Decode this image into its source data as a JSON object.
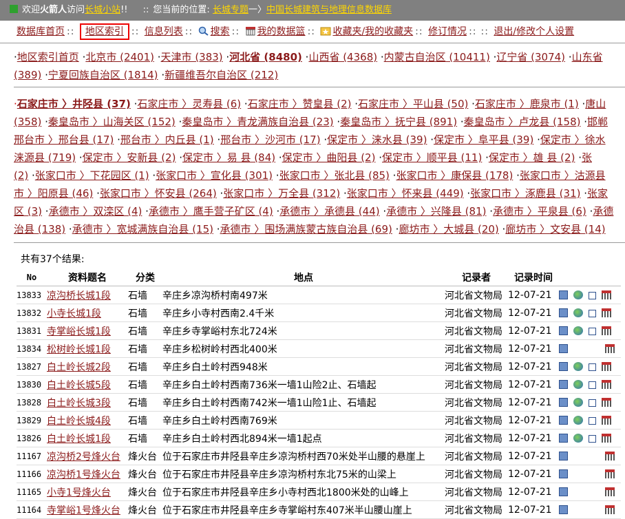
{
  "topbar": {
    "welcome_prefix": "欢迎",
    "user": "火箭人",
    "welcome_mid": "访问",
    "site_link": "长城小站",
    "welcome_suffix": "!!",
    "location_label": "您当前的位置:",
    "crumb_1": "长城专题",
    "crumb_arrow": "一〉",
    "crumb_2": "中国长城建筑与地理信息数据库"
  },
  "nav": {
    "items": [
      "数据库首页",
      "地区索引",
      "信息列表",
      "搜索",
      "我的数据篮",
      "收藏夹/我的收藏夹",
      "修订情况",
      "退出/修改个人设置"
    ],
    "dots": "::"
  },
  "regions": {
    "items": [
      "地区索引首页",
      "北京市 (2401)",
      "天津市 (383)",
      "河北省 (8480)",
      "山西省 (4368)",
      "内蒙古自治区 (10411)",
      "辽宁省 (3074)",
      "山东省",
      "(389)",
      "宁夏回族自治区 (1814)",
      "新疆维吾尔自治区 (212)"
    ]
  },
  "counties": {
    "current": "石家庄市 〉井陉县 (37)",
    "lines": [
      [
        "石家庄市 〉灵寿县 (6)",
        "石家庄市 〉赞皇县 (2)",
        "石家庄市 〉平山县 (50)",
        "石家庄市 〉鹿泉市 (1)",
        "唐山"
      ],
      [
        "(358)",
        "秦皇岛市 〉山海关区 (152)",
        "秦皇岛市 〉青龙满族自治县 (23)",
        "秦皇岛市 〉抚宁县 (891)",
        "秦皇岛市 〉卢龙县 (158)",
        "邯郸"
      ],
      [
        "邢台市 〉邢台县 (17)",
        "邢台市 〉内丘县 (1)",
        "邢台市 〉沙河市 (17)",
        "保定市 〉涞水县 (39)",
        "保定市 〉阜平县 (39)",
        "保定市 〉徐水"
      ],
      [
        "涞源县 (719)",
        "保定市 〉安新县 (2)",
        "保定市 〉易  县 (84)",
        "保定市 〉曲阳县 (2)",
        "保定市 〉顺平县 (11)",
        "保定市 〉雄  县 (2)",
        "张"
      ],
      [
        "(2)",
        "张家口市 〉下花园区 (1)",
        "张家口市 〉宣化县 (301)",
        "张家口市 〉张北县 (85)",
        "张家口市 〉康保县 (178)",
        "张家口市 〉沽源县"
      ],
      [
        "市 〉阳原县 (46)",
        "张家口市 〉怀安县 (264)",
        "张家口市 〉万全县 (312)",
        "张家口市 〉怀来县 (449)",
        "张家口市 〉涿鹿县 (31)",
        "张家"
      ],
      [
        "区 (3)",
        "承德市 〉双滦区 (4)",
        "承德市 〉鹰手营子矿区 (4)",
        "承德市 〉承德县 (44)",
        "承德市 〉兴隆县 (81)",
        "承德市 〉平泉县 (6)",
        "承德"
      ],
      [
        "治县 (138)",
        "承德市 〉宽城满族自治县 (15)",
        "承德市 〉围场满族蒙古族自治县 (69)",
        "廊坊市 〉大城县 (20)",
        "廊坊市 〉文安县 (14)"
      ]
    ]
  },
  "results": {
    "total": "共有37个结果:",
    "headers": [
      "No",
      "资料题名",
      "分类",
      "地点",
      "记录者",
      "记录时间"
    ],
    "rows": [
      {
        "no": "13833",
        "title": "凉沟桥长城1段",
        "type": "石墙",
        "loc": "辛庄乡凉沟桥村南497米",
        "rec": "河北省文物局",
        "time": "12-07-21",
        "icons": 4
      },
      {
        "no": "13832",
        "title": "小寺长城1段",
        "type": "石墙",
        "loc": "辛庄乡小寺村西南2.4千米",
        "rec": "河北省文物局",
        "time": "12-07-21",
        "icons": 4
      },
      {
        "no": "13831",
        "title": "寺掌峪长城1段",
        "type": "石墙",
        "loc": "辛庄乡寺掌峪村东北724米",
        "rec": "河北省文物局",
        "time": "12-07-21",
        "icons": 4
      },
      {
        "no": "13834",
        "title": "松树岭长城1段",
        "type": "石墙",
        "loc": "辛庄乡松树岭村西北400米",
        "rec": "河北省文物局",
        "time": "12-07-21",
        "icons": 2
      },
      {
        "no": "13827",
        "title": "白土岭长城2段",
        "type": "石墙",
        "loc": "辛庄乡白土岭村西948米",
        "rec": "河北省文物局",
        "time": "12-07-21",
        "icons": 4
      },
      {
        "no": "13830",
        "title": "白土岭长城5段",
        "type": "石墙",
        "loc": "辛庄乡白土岭村西南736米一墙1山险2止、石墙起",
        "rec": "河北省文物局",
        "time": "12-07-21",
        "icons": 4
      },
      {
        "no": "13828",
        "title": "白土岭长城3段",
        "type": "石墙",
        "loc": "辛庄乡白土岭村西南742米一墙1山险1止、石墙起",
        "rec": "河北省文物局",
        "time": "12-07-21",
        "icons": 4
      },
      {
        "no": "13829",
        "title": "白土岭长城4段",
        "type": "石墙",
        "loc": "辛庄乡白土岭村西南769米",
        "rec": "河北省文物局",
        "time": "12-07-21",
        "icons": 4
      },
      {
        "no": "13826",
        "title": "白土岭长城1段",
        "type": "石墙",
        "loc": "辛庄乡白土岭村西北894米一墙1起点",
        "rec": "河北省文物局",
        "time": "12-07-21",
        "icons": 4
      },
      {
        "no": "11167",
        "title": "凉沟桥2号烽火台",
        "type": "烽火台",
        "loc": "位于石家庄市井陉县辛庄乡凉沟桥村西70米处半山腰的悬崖上",
        "rec": "河北省文物局",
        "time": "12-07-21",
        "icons": 2
      },
      {
        "no": "11166",
        "title": "凉沟桥1号烽火台",
        "type": "烽火台",
        "loc": "位于石家庄市井陉县辛庄乡凉沟桥村东北75米的山梁上",
        "rec": "河北省文物局",
        "time": "12-07-21",
        "icons": 2
      },
      {
        "no": "11165",
        "title": "小寺1号烽火台",
        "type": "烽火台",
        "loc": "位于石家庄市井陉县辛庄乡小寺村西北1800米处的山峰上",
        "rec": "河北省文物局",
        "time": "12-07-21",
        "icons": 2
      },
      {
        "no": "11164",
        "title": "寺掌峪1号烽火台",
        "type": "烽火台",
        "loc": "位于石家庄市井陉县辛庄乡寺掌峪村东407米半山腰山崖上",
        "rec": "河北省文物局",
        "time": "12-07-21",
        "icons": 2
      }
    ]
  }
}
